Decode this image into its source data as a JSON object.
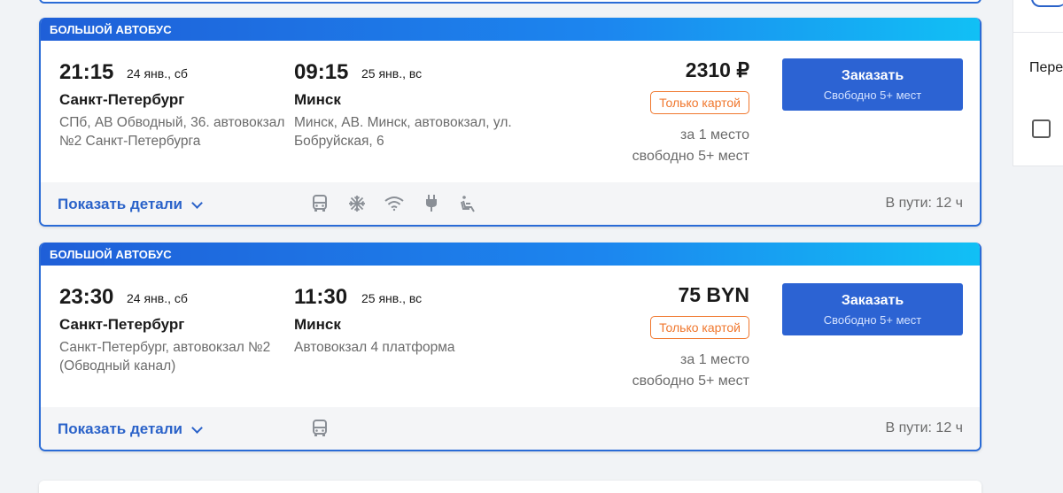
{
  "sidebar": {
    "label": "Пере",
    "checkbox_checked": false
  },
  "trips": [
    {
      "badge": "БОЛЬШОЙ АВТОБУС",
      "depart_time": "21:15",
      "depart_date": "24 янв., сб",
      "depart_city": "Санкт-Петербург",
      "depart_addr": "СПб, АВ Обводный, 36. автовокзал №2 Санкт-Петербурга",
      "arrive_time": "09:15",
      "arrive_date": "25 янв., вс",
      "arrive_city": "Минск",
      "arrive_addr": "Минск, АВ. Минск, автовокзал, ул. Бобруйская, 6",
      "price": "2310 ₽",
      "payment": "Только картой",
      "per_seat": "за 1 место",
      "free": "свободно 5+ мест",
      "order_label": "Заказать",
      "order_sub": "Свободно 5+ мест",
      "details_label": "Показать детали",
      "travel_time": "В пути: 12 ч",
      "amenities": [
        "bus-icon",
        "snowflake-icon",
        "wifi-icon",
        "plug-icon",
        "reclining-seat-icon"
      ]
    },
    {
      "badge": "БОЛЬШОЙ АВТОБУС",
      "depart_time": "23:30",
      "depart_date": "24 янв., сб",
      "depart_city": "Санкт-Петербург",
      "depart_addr": "Санкт-Петербург, автовокзал №2 (Обводный канал)",
      "arrive_time": "11:30",
      "arrive_date": "25 янв., вс",
      "arrive_city": "Минск",
      "arrive_addr": "Автовокзал 4 платформа",
      "price": "75 BYN",
      "payment": "Только картой",
      "per_seat": "за 1 место",
      "free": "свободно 5+ мест",
      "order_label": "Заказать",
      "order_sub": "Свободно 5+ мест",
      "details_label": "Показать детали",
      "travel_time": "В пути: 12 ч",
      "amenities": [
        "bus-icon"
      ]
    }
  ],
  "colors": {
    "accent": "#2c63d3",
    "header_gradient_start": "#1f5fd8",
    "header_gradient_end": "#11c0f5",
    "badge_orange": "#f0772d"
  }
}
